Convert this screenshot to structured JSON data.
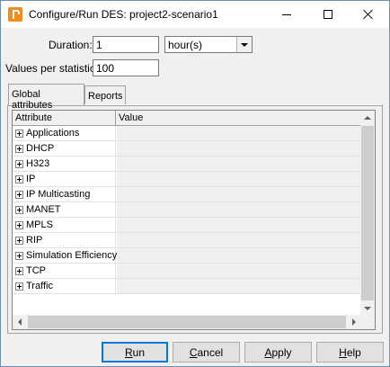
{
  "window": {
    "title": "Configure/Run DES: project2-scenario1"
  },
  "form": {
    "duration_label": "Duration:",
    "duration_value": "1",
    "duration_unit": "hour(s)",
    "values_label": "Values per statistic:",
    "values_value": "100"
  },
  "tabs": [
    {
      "label": "Global attributes",
      "active": true
    },
    {
      "label": "Reports",
      "active": false
    }
  ],
  "grid": {
    "columns": [
      "Attribute",
      "Value"
    ],
    "rows": [
      {
        "label": "Applications"
      },
      {
        "label": "DHCP"
      },
      {
        "label": "H323"
      },
      {
        "label": "IP"
      },
      {
        "label": "IP Multicasting"
      },
      {
        "label": "MANET"
      },
      {
        "label": "MPLS"
      },
      {
        "label": "RIP"
      },
      {
        "label": "Simulation Efficiency"
      },
      {
        "label": "TCP"
      },
      {
        "label": "Traffic"
      }
    ]
  },
  "buttons": {
    "run": {
      "first": "R",
      "rest": "un"
    },
    "cancel": {
      "first": "C",
      "rest": "ancel"
    },
    "apply": {
      "first": "A",
      "rest": "pply"
    },
    "help": {
      "first": "H",
      "rest": "elp"
    }
  }
}
